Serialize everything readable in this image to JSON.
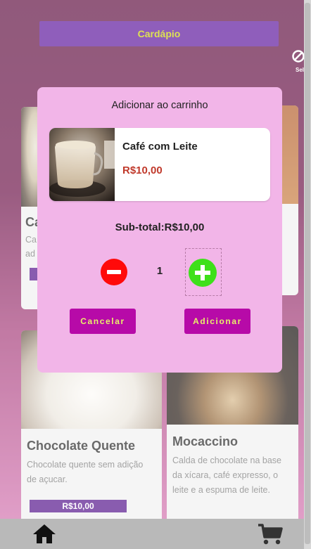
{
  "header": {
    "title": "Cardápio",
    "corner_icon": "block-icon",
    "corner_label": "Sel"
  },
  "background_cards": [
    {
      "id": "cafe-bg",
      "title": "Ca",
      "desc_lines": [
        "Ca",
        "ad"
      ]
    },
    {
      "id": "choc",
      "title": "Chocolate Quente",
      "desc": "Chocolate quente  sem adição de açucar.",
      "price": "R$10,00"
    },
    {
      "id": "moca",
      "title": "Mocaccino",
      "desc": "Calda de chocolate na base da xícara, café expresso, o leite e a espuma de leite."
    }
  ],
  "modal": {
    "title": "Adicionar ao carrinho",
    "product": {
      "name": "Café com Leite",
      "price": "R$10,00",
      "image": "cafe-com-leite-photo"
    },
    "subtotal": "Sub-total:R$10,00",
    "quantity": "1",
    "cancel_label": "Cancelar",
    "add_label": "Adicionar"
  },
  "bottom_nav": {
    "home_icon": "home-icon",
    "cart_icon": "cart-icon"
  },
  "colors": {
    "primary": "#5a139b",
    "accent_text": "#cfd400",
    "modal_bg": "#f2b5e8",
    "button_bg": "#b70aa8",
    "button_text": "#e9ef6a",
    "minus": "#ff0a0a",
    "plus": "#3ee01a",
    "price": "#c0392b"
  }
}
